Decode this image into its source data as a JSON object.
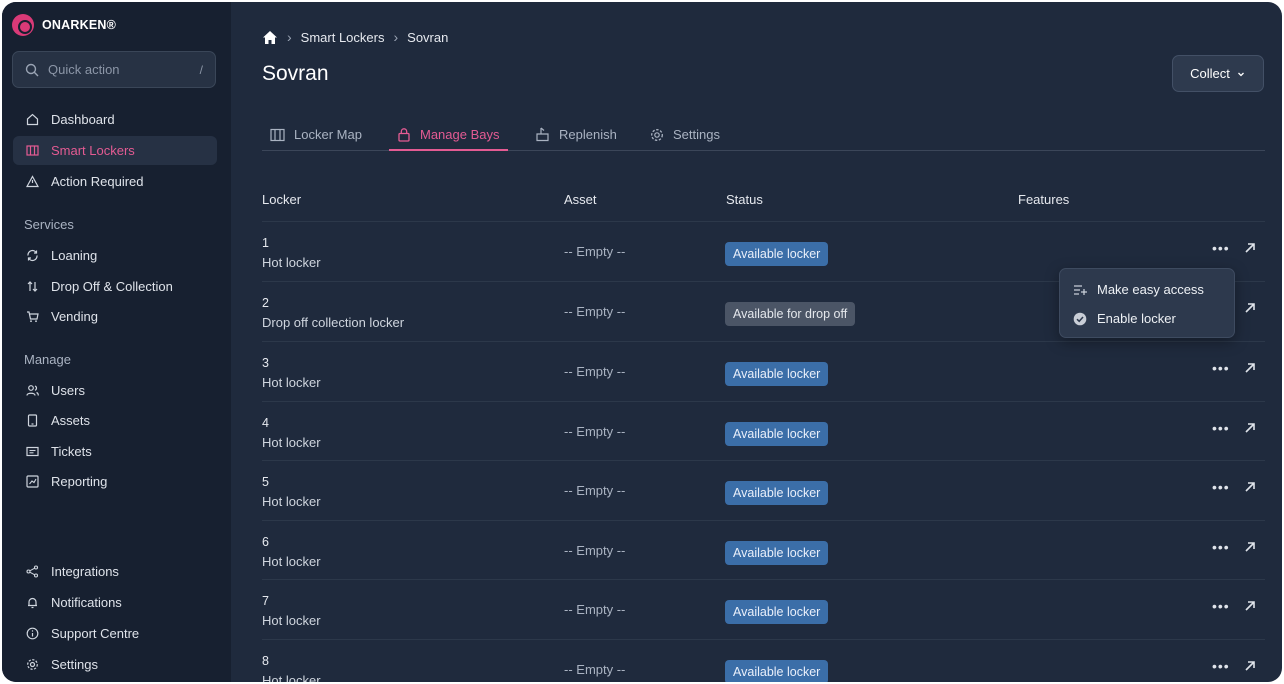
{
  "brand": {
    "name": "ONARKEN®"
  },
  "search": {
    "placeholder": "Quick action",
    "shortcut": "/"
  },
  "sidebar": {
    "primary": [
      {
        "label": "Dashboard",
        "icon": "home-icon"
      },
      {
        "label": "Smart Lockers",
        "icon": "locker-icon",
        "active": true
      },
      {
        "label": "Action Required",
        "icon": "warning-icon"
      }
    ],
    "services_label": "Services",
    "services": [
      {
        "label": "Loaning",
        "icon": "refresh-icon"
      },
      {
        "label": "Drop Off & Collection",
        "icon": "swap-icon"
      },
      {
        "label": "Vending",
        "icon": "cart-icon"
      }
    ],
    "manage_label": "Manage",
    "manage": [
      {
        "label": "Users",
        "icon": "users-icon"
      },
      {
        "label": "Assets",
        "icon": "tablet-icon"
      },
      {
        "label": "Tickets",
        "icon": "ticket-icon"
      },
      {
        "label": "Reporting",
        "icon": "chart-icon"
      }
    ],
    "bottom": [
      {
        "label": "Integrations",
        "icon": "share-icon"
      },
      {
        "label": "Notifications",
        "icon": "bell-icon"
      },
      {
        "label": "Support Centre",
        "icon": "info-icon"
      },
      {
        "label": "Settings",
        "icon": "gear-icon"
      }
    ]
  },
  "breadcrumb": {
    "items": [
      "Smart Lockers",
      "Sovran"
    ]
  },
  "page": {
    "title": "Sovran",
    "collect_label": "Collect"
  },
  "tabs": [
    {
      "label": "Locker Map"
    },
    {
      "label": "Manage Bays",
      "active": true
    },
    {
      "label": "Replenish"
    },
    {
      "label": "Settings"
    }
  ],
  "table": {
    "headers": [
      "Locker",
      "Asset",
      "Status",
      "Features"
    ],
    "rows": [
      {
        "num": "1",
        "type": "Hot locker",
        "asset": "-- Empty --",
        "status": "Available locker",
        "status_style": "blue"
      },
      {
        "num": "2",
        "type": "Drop off collection locker",
        "asset": "-- Empty --",
        "status": "Available for drop off",
        "status_style": "grey"
      },
      {
        "num": "3",
        "type": "Hot locker",
        "asset": "-- Empty --",
        "status": "Available locker",
        "status_style": "blue"
      },
      {
        "num": "4",
        "type": "Hot locker",
        "asset": "-- Empty --",
        "status": "Available locker",
        "status_style": "blue"
      },
      {
        "num": "5",
        "type": "Hot locker",
        "asset": "-- Empty --",
        "status": "Available locker",
        "status_style": "blue"
      },
      {
        "num": "6",
        "type": "Hot locker",
        "asset": "-- Empty --",
        "status": "Available locker",
        "status_style": "blue"
      },
      {
        "num": "7",
        "type": "Hot locker",
        "asset": "-- Empty --",
        "status": "Available locker",
        "status_style": "blue"
      },
      {
        "num": "8",
        "type": "Hot locker",
        "asset": "-- Empty --",
        "status": "Available locker",
        "status_style": "blue"
      }
    ],
    "more_label": "•••"
  },
  "row_menu": {
    "options": [
      {
        "label": "Make easy access",
        "icon": "list-add-icon"
      },
      {
        "label": "Enable locker",
        "icon": "check-circle-icon"
      }
    ]
  },
  "colors": {
    "accent": "#e45b93",
    "badge_blue": "#3b6ea8",
    "badge_grey": "#4b5566",
    "sidebar_bg": "#172030",
    "main_bg": "#1f2a3d"
  }
}
